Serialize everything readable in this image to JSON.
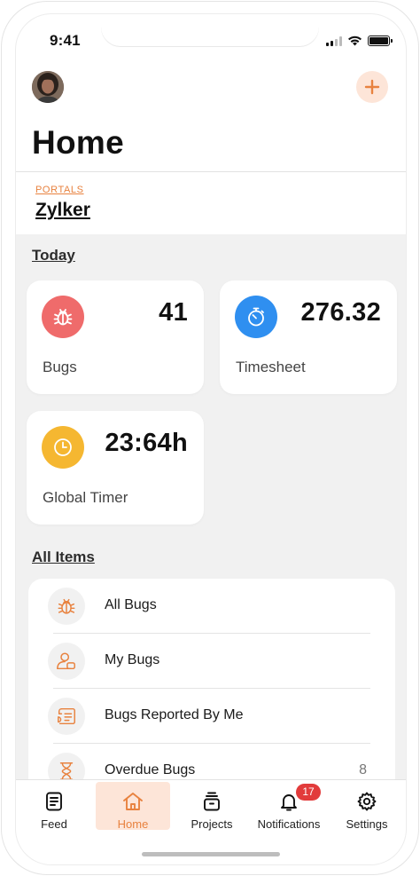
{
  "status_bar": {
    "time": "9:41"
  },
  "header": {
    "title": "Home",
    "add_icon": "plus-icon"
  },
  "portal": {
    "label": "PORTALS",
    "name": "Zylker"
  },
  "today": {
    "title": "Today",
    "cards": [
      {
        "label": "Bugs",
        "value": "41",
        "icon": "bug-icon",
        "color": "#ef6b6b"
      },
      {
        "label": "Timesheet",
        "value": "276.32",
        "icon": "stopwatch-icon",
        "color": "#2f8ff0"
      },
      {
        "label": "Global Timer",
        "value": "23:64h",
        "icon": "clock-icon",
        "color": "#f5b731"
      }
    ]
  },
  "all_items": {
    "title": "All Items",
    "items": [
      {
        "label": "All Bugs",
        "icon": "bug-icon",
        "count": ""
      },
      {
        "label": "My Bugs",
        "icon": "user-bug-icon",
        "count": ""
      },
      {
        "label": "Bugs Reported By Me",
        "icon": "reported-icon",
        "count": ""
      },
      {
        "label": "Overdue Bugs",
        "icon": "hourglass-icon",
        "count": "8"
      }
    ]
  },
  "tabbar": {
    "tabs": [
      {
        "label": "Feed",
        "icon": "feed-icon"
      },
      {
        "label": "Home",
        "icon": "home-icon",
        "active": true
      },
      {
        "label": "Projects",
        "icon": "projects-icon"
      },
      {
        "label": "Notifications",
        "icon": "bell-icon",
        "badge": "17"
      },
      {
        "label": "Settings",
        "icon": "gear-icon"
      }
    ]
  },
  "colors": {
    "accent": "#e8823f",
    "accent_soft": "#fde5d8",
    "badge": "#e23b3b"
  }
}
